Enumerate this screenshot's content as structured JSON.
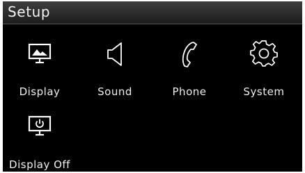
{
  "header": {
    "title": "Setup"
  },
  "menu": {
    "items": [
      {
        "label": "Display",
        "icon": "display-icon"
      },
      {
        "label": "Sound",
        "icon": "speaker-icon"
      },
      {
        "label": "Phone",
        "icon": "phone-icon"
      },
      {
        "label": "System",
        "icon": "gear-icon"
      },
      {
        "label": "Display Off",
        "icon": "display-off-icon"
      }
    ]
  },
  "colors": {
    "background": "#000000",
    "header": "#2e2e2e",
    "text": "#ffffff"
  }
}
